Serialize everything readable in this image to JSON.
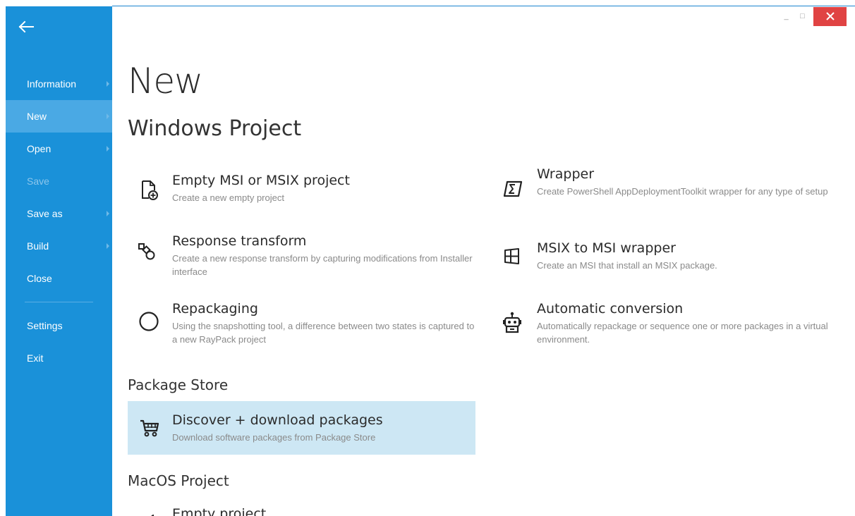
{
  "sidebar": {
    "items": [
      {
        "label": "Information",
        "has_arrow": true
      },
      {
        "label": "New",
        "has_arrow": true,
        "active": true
      },
      {
        "label": "Open",
        "has_arrow": true
      },
      {
        "label": "Save",
        "disabled": true
      },
      {
        "label": "Save as",
        "has_arrow": true
      },
      {
        "label": "Build",
        "has_arrow": true
      },
      {
        "label": "Close"
      }
    ],
    "bottom_items": [
      {
        "label": "Settings"
      },
      {
        "label": "Exit"
      }
    ]
  },
  "window_controls": {
    "minimize": "_",
    "maximize": "□",
    "close_icon": "close-icon"
  },
  "main": {
    "title": "New",
    "windows_section": {
      "title": "Windows Project",
      "tiles": [
        {
          "icon": "new-file-icon",
          "title": "Empty MSI or MSIX project",
          "desc": "Create a new empty project"
        },
        {
          "icon": "powershell-icon",
          "title": "Wrapper",
          "desc": "Create PowerShell AppDeploymentToolkit wrapper for any type of setup"
        },
        {
          "icon": "transform-icon",
          "title": "Response transform",
          "desc": "Create a new response transform by capturing modifications from Installer interface"
        },
        {
          "icon": "windows-icon",
          "title": "MSIX to MSI wrapper",
          "desc": "Create an MSI that install an MSIX package."
        },
        {
          "icon": "circle-icon",
          "title": "Repackaging",
          "desc": "Using the snapshotting tool, a difference between two states is captured to a new RayPack project"
        },
        {
          "icon": "robot-icon",
          "title": "Automatic conversion",
          "desc": "Automatically repackage or sequence one or more packages in a virtual environment."
        }
      ]
    },
    "package_store": {
      "title": "Package Store",
      "tile": {
        "icon": "cart-icon",
        "title": "Discover + download packages",
        "desc": "Download software packages from Package Store"
      }
    },
    "macos_section": {
      "title": "MacOS Project",
      "tile": {
        "icon": "apple-icon",
        "title": "Empty project"
      }
    }
  },
  "colors": {
    "sidebar": "#1a91d9",
    "sidebar_active": "#4aa9e4",
    "close_button": "#e04343",
    "highlight": "#cde7f4"
  }
}
